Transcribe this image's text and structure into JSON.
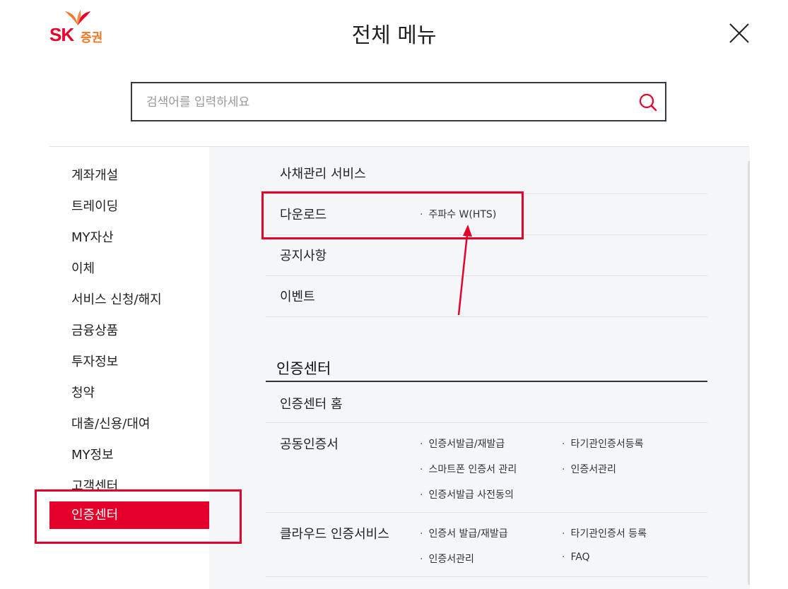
{
  "logo": {
    "brand": "SK",
    "suffix": "증권"
  },
  "header": {
    "title": "전체 메뉴"
  },
  "search": {
    "placeholder": "검색어를 입력하세요"
  },
  "left_nav": {
    "items": [
      "계좌개설",
      "트레이딩",
      "MY자산",
      "이체",
      "서비스 신청/해지",
      "금융상품",
      "투자정보",
      "청약",
      "대출/신용/대여",
      "MY정보",
      "고객센터"
    ],
    "active": "인증센터"
  },
  "right": {
    "top_rows": [
      {
        "label": "사채관리 서비스",
        "subs": []
      },
      {
        "label": "다운로드",
        "subs": [
          "주파수 W(HTS)"
        ]
      },
      {
        "label": "공지사항",
        "subs": []
      },
      {
        "label": "이벤트",
        "subs": []
      }
    ],
    "section_title": "인증센터",
    "cert_rows": [
      {
        "label": "인증센터 홈",
        "subs": []
      },
      {
        "label": "공동인증서",
        "subs": [
          "인증서발급/재발급",
          "타기관인증서등록",
          "스마트폰 인증서 관리",
          "인증서관리",
          "인증서발급 사전동의"
        ]
      },
      {
        "label": "클라우드 인증서비스",
        "subs": [
          "인증서 발급/재발급",
          "타기관인증서 등록",
          "인증서관리",
          "FAQ"
        ]
      }
    ]
  },
  "colors": {
    "accent": "#e5002b",
    "panel_bg": "#f4f6f8",
    "logo_orange": "#f47725"
  },
  "icons": {
    "close": "close-icon",
    "search": "search-icon"
  }
}
